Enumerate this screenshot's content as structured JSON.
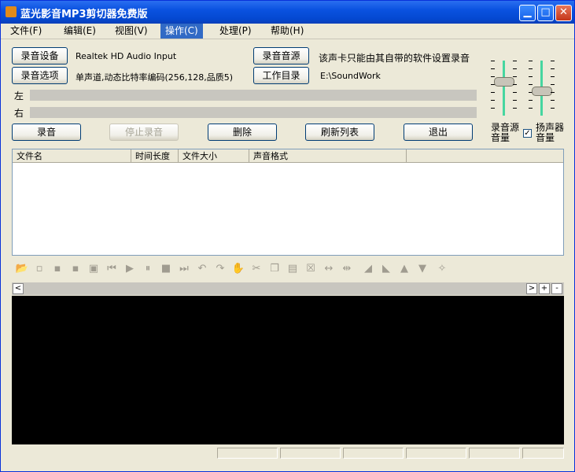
{
  "window": {
    "title": "蓝光影音MP3剪切器免费版",
    "minimize_glyph": "▁",
    "maximize_glyph": "□",
    "close_glyph": "✕"
  },
  "menu": [
    "文件(F)",
    "编辑(E)",
    "视图(V)",
    "操作(C)",
    "处理(P)",
    "帮助(H)"
  ],
  "active_menu": "操作(C)",
  "record": {
    "device_button": "录音设备",
    "device_value": "Realtek HD Audio Input",
    "options_button": "录音选项",
    "options_value": "单声道,动态比特率编码(256,128,品质5)",
    "source_button": "录音音源",
    "source_note": "该声卡只能由其自带的软件设置录音",
    "workdir_button": "工作目录",
    "workdir_value": "E:\\SoundWork",
    "left_label": "左",
    "right_label": "右"
  },
  "actions": {
    "record": "录音",
    "stop": "停止录音",
    "delete": "删除",
    "refresh": "刷新列表",
    "exit": "退出"
  },
  "volume": {
    "source_label_1": "录音源",
    "source_label_2": "音量",
    "speaker_label_1": "扬声器",
    "speaker_label_2": "音量",
    "speaker_checked": true,
    "checkmark": "✓",
    "source_level": 0.65,
    "speaker_level": 0.45
  },
  "file_list": {
    "columns": [
      "文件名",
      "时间长度",
      "文件大小",
      "声音格式"
    ]
  },
  "toolbar_icons": [
    "open-icon",
    "new-icon",
    "save-icon",
    "save-as-icon",
    "export-icon",
    "skip-start-icon",
    "play-icon",
    "pause-icon",
    "stop-icon",
    "skip-end-icon",
    "undo-icon",
    "redo-icon",
    "hand-icon",
    "cut-icon",
    "copy-icon",
    "paste-icon",
    "delete-icon",
    "trim-icon",
    "insert-silence-icon",
    "fade-in-icon",
    "fade-out-icon",
    "volume-up-icon",
    "volume-down-icon",
    "effect-icon"
  ],
  "scroll": {
    "left": "<",
    "right": ">",
    "zoom_in": "+",
    "zoom_out": "-"
  }
}
